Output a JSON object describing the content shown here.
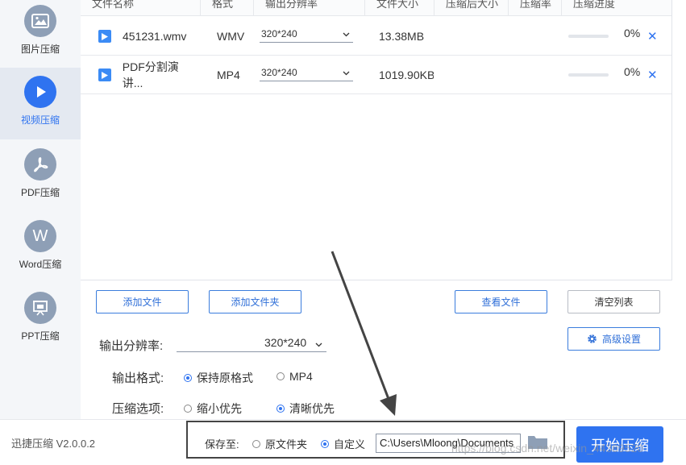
{
  "sidebar": {
    "items": [
      {
        "label": "图片压缩",
        "icon": "image-icon",
        "active": false
      },
      {
        "label": "视频压缩",
        "icon": "play-icon",
        "active": true
      },
      {
        "label": "PDF压缩",
        "icon": "pdf-icon",
        "active": false
      },
      {
        "label": "Word压缩",
        "icon": "word-icon",
        "glyph": "W",
        "active": false
      },
      {
        "label": "PPT压缩",
        "icon": "ppt-icon",
        "active": false
      }
    ]
  },
  "table": {
    "headers": [
      "文件名称",
      "格式",
      "输出分辨率",
      "文件大小",
      "压缩后大小",
      "压缩率",
      "压缩进度"
    ],
    "rows": [
      {
        "name": "451231.wmv",
        "format": "WMV",
        "resolution": "320*240",
        "size": "13.38MB",
        "compressed": "",
        "ratio": "",
        "progress": "0%"
      },
      {
        "name": "PDF分割演讲...",
        "format": "MP4",
        "resolution": "320*240",
        "size": "1019.90KB",
        "compressed": "",
        "ratio": "",
        "progress": "0%"
      }
    ]
  },
  "buttons": {
    "add_file": "添加文件",
    "add_folder": "添加文件夹",
    "view_files": "查看文件",
    "clear_list": "清空列表",
    "advanced": "高级设置",
    "start": "开始压缩"
  },
  "settings": {
    "resolution_label": "输出分辨率:",
    "resolution_value": "320*240",
    "format_label": "输出格式:",
    "format_options": [
      {
        "label": "保持原格式",
        "selected": true
      },
      {
        "label": "MP4",
        "selected": false
      }
    ],
    "compress_label": "压缩选项:",
    "compress_options": [
      {
        "label": "缩小优先",
        "selected": false
      },
      {
        "label": "清晰优先",
        "selected": true
      }
    ]
  },
  "footer": {
    "version": "迅捷压缩 V2.0.0.2",
    "save_label": "保存至:",
    "save_options": [
      {
        "label": "原文件夹",
        "selected": false
      },
      {
        "label": "自定义",
        "selected": true
      }
    ],
    "path": "C:\\Users\\Mloong\\Documents",
    "watermark": "https://blog.csdn.net/weixin_44389520"
  },
  "colors": {
    "accent": "#2f73f0",
    "sidebar_bg": "#f4f6f9",
    "annotation": "#444444"
  }
}
